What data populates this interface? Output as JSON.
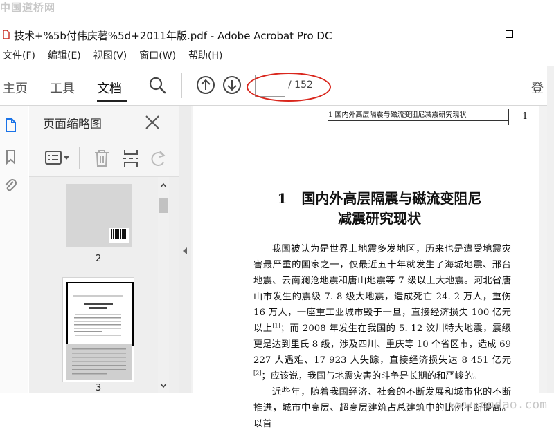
{
  "watermark": {
    "site_name": "中国道桥网",
    "url": "www.cndao.com"
  },
  "window": {
    "title": "技术+%5b付伟庆著%5d+2011年版.pdf - Adobe Acrobat Pro DC"
  },
  "menu": {
    "items": [
      "文件(F)",
      "编辑(E)",
      "视图(V)",
      "窗口(W)",
      "帮助(H)"
    ]
  },
  "toolbar": {
    "tabs": [
      "主页",
      "工具",
      "文档"
    ],
    "active_tab": "文档",
    "page_input_value": "",
    "page_total": "/ 152",
    "login_label": "登"
  },
  "thumbnails": {
    "panel_title": "页面缩略图",
    "page_labels": [
      "2",
      "3"
    ],
    "selected_page": "3"
  },
  "document": {
    "running_head": "1    国内外高层隔震与磁流变阻尼减震研究现状",
    "page_number": "1",
    "chapter_number": "1",
    "chapter_title_line1": "国内外高层隔震与磁流变阻尼",
    "chapter_title_line2": "减震研究现状",
    "paragraph1_a": "我国被认为是世界上地震多发地区，历来也是遭受地震灾害最严重的国家之一，仅最近五十年就发生了海城地震、邢台地震、云南澜沧地震和唐山地震等 7 级以上大地震。河北省唐山市发生的震级 7. 8 级大地震，造成死亡 24. 2 万人，重伤 16 万人，一座重工业城市毁于一旦，直接经济损失 100 亿元以上",
    "paragraph1_ref1": "[1]",
    "paragraph1_b": "；而 2008 年发生在我国的 5. 12 汶川特大地震，震级更是达到里氏 8 级，涉及四川、重庆等 10 个省区市，造成 69 227 人遇难、17 923 人失踪，直接经济损失达 8 451 亿元",
    "paragraph1_ref2": "[2]",
    "paragraph1_c": "；应该说，我国与地震灾害的斗争是长期的和严峻的。",
    "paragraph2": "近些年，随着我国经济、社会的不断发展和城市化的不断推进，城市中高层、超高层建筑占总建筑中的比例不断提高。以首"
  },
  "colors": {
    "annotation_red": "#d9261c",
    "panel_bg": "#f5f5f5",
    "active_tab_underline": "#222222"
  },
  "icons": [
    "pdf-file-icon",
    "search-icon",
    "prev-page-icon",
    "next-page-icon",
    "page-thumbnails-icon",
    "bookmark-icon",
    "attachment-icon",
    "close-icon",
    "options-menu-icon",
    "delete-page-icon",
    "insert-page-icon",
    "rotate-icon",
    "collapse-panel-icon",
    "scroll-up-icon",
    "scroll-down-icon"
  ]
}
